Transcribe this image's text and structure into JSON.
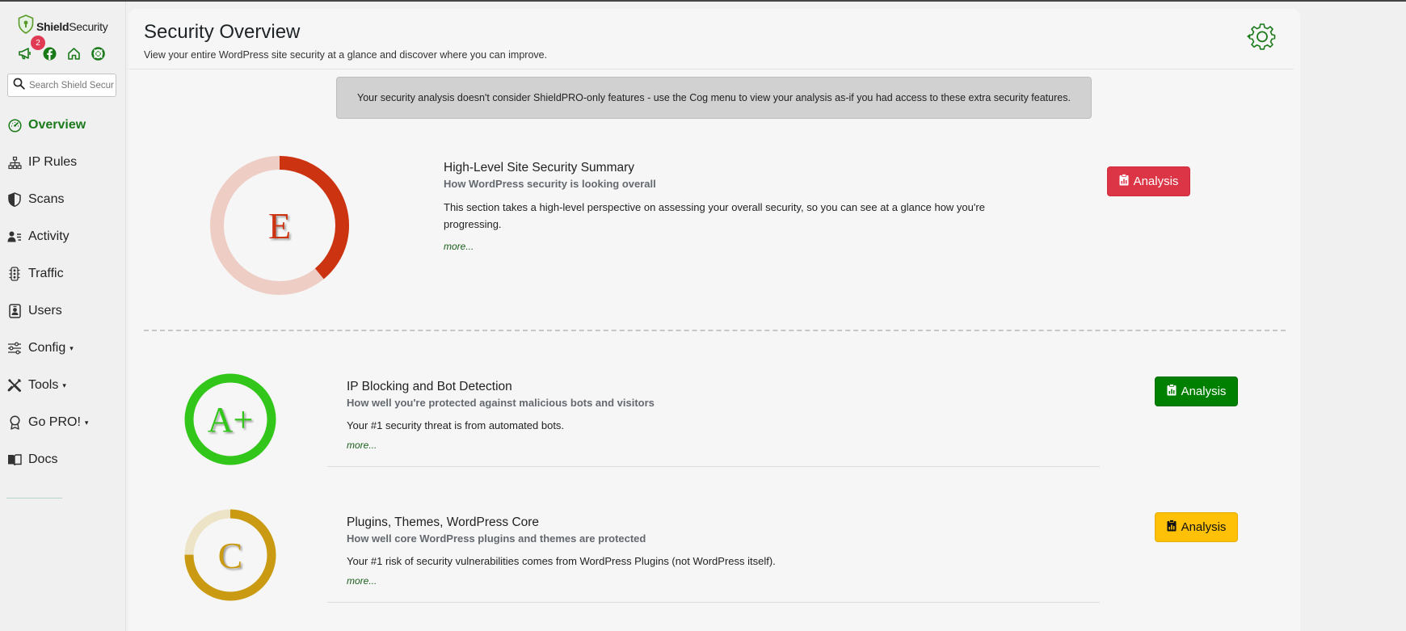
{
  "sidebar": {
    "logo_bold": "Shield",
    "logo_rest": "Security",
    "notification_count": "2",
    "search_placeholder": "Search Shield Security",
    "items": [
      {
        "label": "Overview",
        "icon": "speedometer-icon",
        "active": true
      },
      {
        "label": "IP Rules",
        "icon": "network-icon"
      },
      {
        "label": "Scans",
        "icon": "shield-half-icon"
      },
      {
        "label": "Activity",
        "icon": "person-lines-icon"
      },
      {
        "label": "Traffic",
        "icon": "traffic-light-icon"
      },
      {
        "label": "Users",
        "icon": "person-badge-icon"
      },
      {
        "label": "Config",
        "icon": "sliders-icon",
        "caret": "▾"
      },
      {
        "label": "Tools",
        "icon": "tools-icon",
        "caret": "▾"
      },
      {
        "label": "Go PRO!",
        "icon": "award-icon",
        "caret": "▾"
      },
      {
        "label": "Docs",
        "icon": "book-icon"
      }
    ]
  },
  "header": {
    "title": "Security Overview",
    "subtitle": "View your entire WordPress site security at a glance and discover where you can improve."
  },
  "notice": "Your security analysis doesn't consider ShieldPRO-only features - use the Cog menu to view your analysis as-if you had access to these extra security features.",
  "sections": [
    {
      "grade": "E",
      "score_fraction": 0.39,
      "title": "High-Level Site Security Summary",
      "subtitle": "How WordPress security is looking overall",
      "description": "This section takes a high-level perspective on assessing your overall security, so you can see at a glance how you're progressing.",
      "more": "more...",
      "button": "Analysis"
    },
    {
      "grade": "A+",
      "score_fraction": 1.0,
      "title": "IP Blocking and Bot Detection",
      "subtitle": "How well you're protected against malicious bots and visitors",
      "description": "Your #1 security threat is from automated bots.",
      "more": "more...",
      "button": "Analysis"
    },
    {
      "grade": "C",
      "score_fraction": 0.75,
      "title": "Plugins, Themes, WordPress Core",
      "subtitle": "How well core WordPress plugins and themes are protected",
      "description": "Your #1 risk of security vulnerabilities comes from WordPress Plugins (not WordPress itself).",
      "more": "more...",
      "button": "Analysis"
    }
  ],
  "colors": {
    "brand_green": "#1a7a1a",
    "grade_e": "#cc3311",
    "grade_e_track": "#eecdc4",
    "grade_a": "#33c61a",
    "grade_c": "#c99a12",
    "grade_c_track": "#ede3c7",
    "btn_red": "#dc3545",
    "btn_green": "#008000",
    "btn_yellow": "#ffc107"
  }
}
